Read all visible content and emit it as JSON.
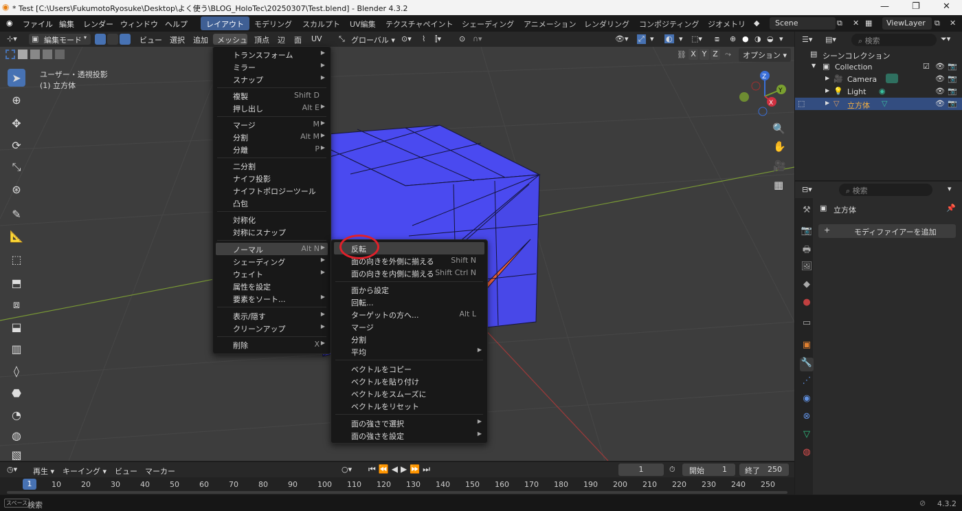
{
  "window": {
    "title": "* Test [C:\\Users\\FukumotoRyosuke\\Desktop\\よく使う\\BLOG_HoloTec\\20250307\\Test.blend] - Blender 4.3.2"
  },
  "menubar": {
    "items": [
      "ファイル",
      "編集",
      "レンダー",
      "ウィンドウ",
      "ヘルプ"
    ]
  },
  "workspaces": {
    "tabs": [
      "レイアウト",
      "モデリング",
      "スカルプト",
      "UV編集",
      "テクスチャペイント",
      "シェーディング",
      "アニメーション",
      "レンダリング",
      "コンポジティング",
      "ジオメトリ"
    ]
  },
  "scene": {
    "name": "Scene",
    "view_layer": "ViewLayer"
  },
  "viewport_header": {
    "mode": "編集モード",
    "menus": [
      "ビュー",
      "選択",
      "追加",
      "メッシュ",
      "頂点",
      "辺",
      "面",
      "UV"
    ],
    "orientation": "グローバル",
    "axes": [
      "X",
      "Y",
      "Z"
    ],
    "options": "オプション"
  },
  "viewport": {
    "view_name": "ユーザー・透視投影",
    "object_label": "(1) 立方体",
    "gizmo": {
      "x": "X",
      "y": "Y",
      "z": "Z"
    }
  },
  "mesh_menu": {
    "items": [
      {
        "label": "トランスフォーム",
        "shortcut": "",
        "sub": true
      },
      {
        "label": "ミラー",
        "shortcut": "",
        "sub": true
      },
      {
        "label": "スナップ",
        "shortcut": "",
        "sub": true
      },
      {
        "label": "複製",
        "shortcut": "Shift D",
        "sub": false
      },
      {
        "label": "押し出し",
        "shortcut": "Alt E",
        "sub": true
      },
      {
        "label": "マージ",
        "shortcut": "M",
        "sub": true
      },
      {
        "label": "分割",
        "shortcut": "Alt M",
        "sub": true
      },
      {
        "label": "分離",
        "shortcut": "P",
        "sub": true
      },
      {
        "label": "二分割",
        "shortcut": "",
        "sub": false
      },
      {
        "label": "ナイフ投影",
        "shortcut": "",
        "sub": false
      },
      {
        "label": "ナイフトポロジーツール",
        "shortcut": "",
        "sub": false
      },
      {
        "label": "凸包",
        "shortcut": "",
        "sub": false
      },
      {
        "label": "対称化",
        "shortcut": "",
        "sub": false
      },
      {
        "label": "対称にスナップ",
        "shortcut": "",
        "sub": false
      },
      {
        "label": "ノーマル",
        "shortcut": "Alt N",
        "sub": true
      },
      {
        "label": "シェーディング",
        "shortcut": "",
        "sub": true
      },
      {
        "label": "ウェイト",
        "shortcut": "",
        "sub": true
      },
      {
        "label": "属性を設定",
        "shortcut": "",
        "sub": false
      },
      {
        "label": "要素をソート...",
        "shortcut": "",
        "sub": true
      },
      {
        "label": "表示/隠す",
        "shortcut": "",
        "sub": true
      },
      {
        "label": "クリーンアップ",
        "shortcut": "",
        "sub": true
      },
      {
        "label": "削除",
        "shortcut": "X",
        "sub": true
      }
    ]
  },
  "normal_menu": {
    "items": [
      {
        "label": "反転",
        "shortcut": "",
        "sub": false
      },
      {
        "label": "面の向きを外側に揃える",
        "shortcut": "Shift N",
        "sub": false
      },
      {
        "label": "面の向きを内側に揃える",
        "shortcut": "Shift Ctrl N",
        "sub": false
      },
      {
        "label": "面から設定",
        "shortcut": "",
        "sub": false
      },
      {
        "label": "回転...",
        "shortcut": "",
        "sub": false
      },
      {
        "label": "ターゲットの方へ...",
        "shortcut": "Alt L",
        "sub": false
      },
      {
        "label": "マージ",
        "shortcut": "",
        "sub": false
      },
      {
        "label": "分割",
        "shortcut": "",
        "sub": false
      },
      {
        "label": "平均",
        "shortcut": "",
        "sub": true
      },
      {
        "label": "ベクトルをコピー",
        "shortcut": "",
        "sub": false
      },
      {
        "label": "ベクトルを貼り付け",
        "shortcut": "",
        "sub": false
      },
      {
        "label": "ベクトルをスムーズに",
        "shortcut": "",
        "sub": false
      },
      {
        "label": "ベクトルをリセット",
        "shortcut": "",
        "sub": false
      },
      {
        "label": "面の強さで選択",
        "shortcut": "",
        "sub": true
      },
      {
        "label": "面の強さを設定",
        "shortcut": "",
        "sub": true
      }
    ]
  },
  "outliner": {
    "search_placeholder": "検索",
    "scene_collection": "シーンコレクション",
    "collection": "Collection",
    "objects": [
      "Camera",
      "Light",
      "立方体"
    ]
  },
  "properties": {
    "search_placeholder": "検索",
    "object_name": "立方体",
    "add_modifier": "モディファイアーを追加"
  },
  "timeline": {
    "playback": "再生",
    "keying": "キーイング",
    "view": "ビュー",
    "marker": "マーカー",
    "current_frame": "1",
    "start_label": "開始",
    "start": "1",
    "end_label": "終了",
    "end": "250",
    "ticks": [
      "10",
      "20",
      "30",
      "40",
      "50",
      "60",
      "70",
      "80",
      "90",
      "100",
      "110",
      "120",
      "130",
      "140",
      "150",
      "160",
      "170",
      "180",
      "190",
      "200",
      "210",
      "220",
      "230",
      "240",
      "250"
    ]
  },
  "statusbar": {
    "space_key": "スペース",
    "search": "検索",
    "version": "4.3.2"
  },
  "colors": {
    "accent": "#4772b3",
    "active_tab": "#3f5f94",
    "mesh_face": "#4a4af0",
    "flipped_face": "#e8603a",
    "annotation": "#e0202a"
  }
}
